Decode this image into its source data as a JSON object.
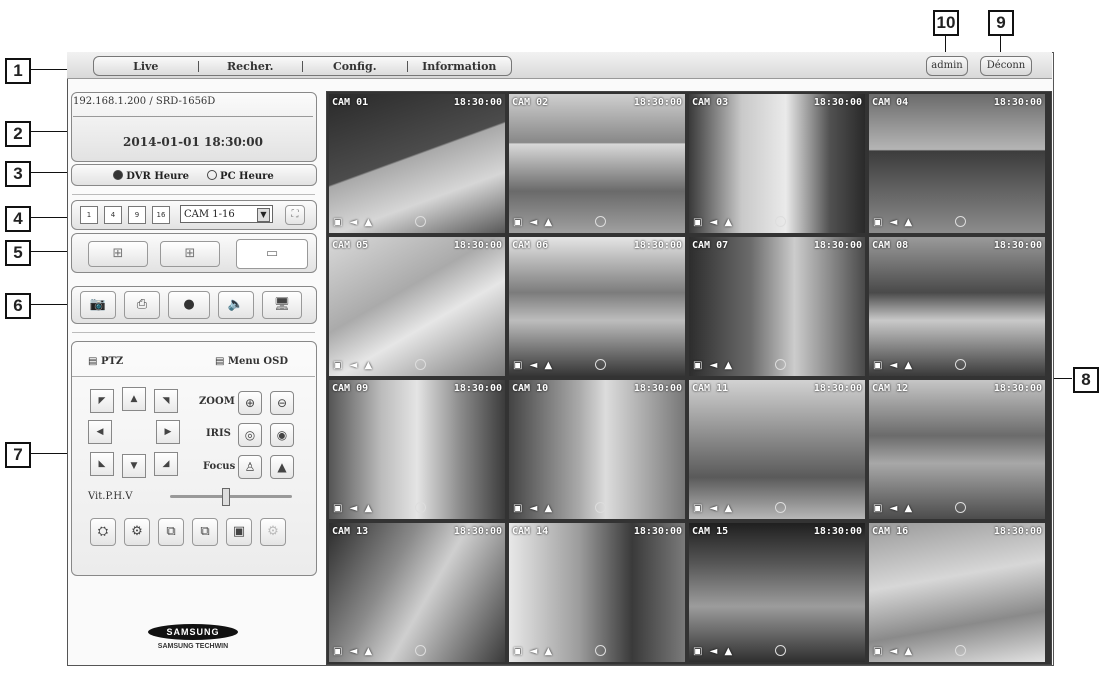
{
  "menu": {
    "items": [
      "Live",
      "Recher.",
      "Config.",
      "Information"
    ]
  },
  "header": {
    "user": "admin",
    "logout": "Déconn"
  },
  "status": {
    "address": "192.168.1.200 / SRD-1656D",
    "datetime": "2014-01-01 18:30:00"
  },
  "time_source": {
    "options": [
      "DVR Heure",
      "PC Heure"
    ],
    "selected": "DVR Heure"
  },
  "split": {
    "modes": [
      "1",
      "4",
      "9",
      "16"
    ],
    "camera_select": "CAM 1-16"
  },
  "ptz": {
    "tab_ptz": "PTZ",
    "tab_osd": "Menu OSD",
    "zoom": "ZOOM",
    "iris": "IRIS",
    "focus": "Focus",
    "speed": "Vit.P.H.V",
    "speed_level": 0.45
  },
  "brand": {
    "logo": "SAMSUNG",
    "name": "SAMSUNG TECHWIN"
  },
  "callouts": [
    "1",
    "2",
    "3",
    "4",
    "5",
    "6",
    "7",
    "8",
    "9",
    "10"
  ],
  "cameras": [
    {
      "name": "CAM 01",
      "time": "18:30:00"
    },
    {
      "name": "CAM 02",
      "time": "18:30:00"
    },
    {
      "name": "CAM 03",
      "time": "18:30:00"
    },
    {
      "name": "CAM 04",
      "time": "18:30:00"
    },
    {
      "name": "CAM 05",
      "time": "18:30:00"
    },
    {
      "name": "CAM 06",
      "time": "18:30:00"
    },
    {
      "name": "CAM 07",
      "time": "18:30:00"
    },
    {
      "name": "CAM 08",
      "time": "18:30:00"
    },
    {
      "name": "CAM 09",
      "time": "18:30:00"
    },
    {
      "name": "CAM 10",
      "time": "18:30:00"
    },
    {
      "name": "CAM 11",
      "time": "18:30:00"
    },
    {
      "name": "CAM 12",
      "time": "18:30:00"
    },
    {
      "name": "CAM 13",
      "time": "18:30:00"
    },
    {
      "name": "CAM 14",
      "time": "18:30:00"
    },
    {
      "name": "CAM 15",
      "time": "18:30:00"
    },
    {
      "name": "CAM 16",
      "time": "18:30:00"
    }
  ]
}
